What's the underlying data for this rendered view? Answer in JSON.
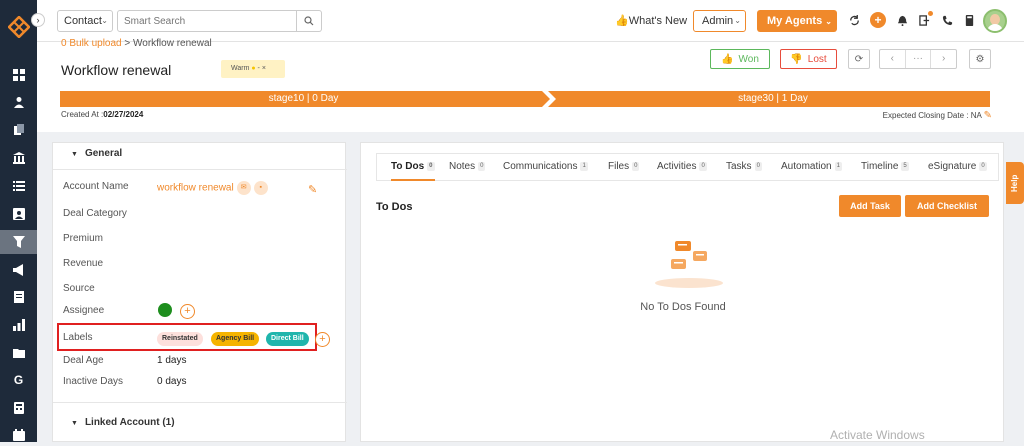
{
  "topbar": {
    "contact_label": "Contact",
    "search_placeholder": "Smart Search",
    "whats_new": "What's New",
    "admin_label": "Admin",
    "my_agents": "My Agents"
  },
  "header": {
    "breadcrumb_link": "0 Bulk upload",
    "breadcrumb_rest": " > Workflow renewal",
    "title": "Workflow renewal",
    "warm_tag": "Warm",
    "won": "Won",
    "lost": "Lost",
    "stages": [
      "stage10 | 0 Day",
      "stage30 | 1 Day"
    ],
    "created_label": "Created At :",
    "created_value": "02/27/2024",
    "closing": "Expected Closing Date : NA"
  },
  "general": {
    "section_title": "General",
    "fields": [
      {
        "label": "Account Name",
        "value": "workflow renewal"
      },
      {
        "label": "Deal Category",
        "value": ""
      },
      {
        "label": "Premium",
        "value": ""
      },
      {
        "label": "Revenue",
        "value": ""
      },
      {
        "label": "Source",
        "value": ""
      },
      {
        "label": "Assignee",
        "value": ""
      },
      {
        "label": "Labels",
        "value": ""
      },
      {
        "label": "Deal Age",
        "value": "1 days"
      },
      {
        "label": "Inactive Days",
        "value": "0 days"
      }
    ],
    "labels": [
      "Reinstated",
      "Agency Bill",
      "Direct Bill"
    ],
    "linked_title": "Linked Account (1)"
  },
  "tabs": [
    {
      "label": "To Dos",
      "count": "0"
    },
    {
      "label": "Notes",
      "count": "0"
    },
    {
      "label": "Communications",
      "count": "1"
    },
    {
      "label": "Files",
      "count": "0"
    },
    {
      "label": "Activities",
      "count": "0"
    },
    {
      "label": "Tasks",
      "count": "0"
    },
    {
      "label": "Automation",
      "count": "1"
    },
    {
      "label": "Timeline",
      "count": "5"
    },
    {
      "label": "eSignature",
      "count": "0"
    }
  ],
  "todos": {
    "title": "To Dos",
    "add_task": "Add Task",
    "add_checklist": "Add Checklist",
    "empty": "No To Dos Found"
  },
  "help": "Help",
  "watermark": "Activate Windows",
  "colors": {
    "accent": "#f0892b",
    "sidebar": "#1e2a3a",
    "won": "#5cb85c",
    "lost": "#e74c3c",
    "highlight": "#e02020"
  }
}
